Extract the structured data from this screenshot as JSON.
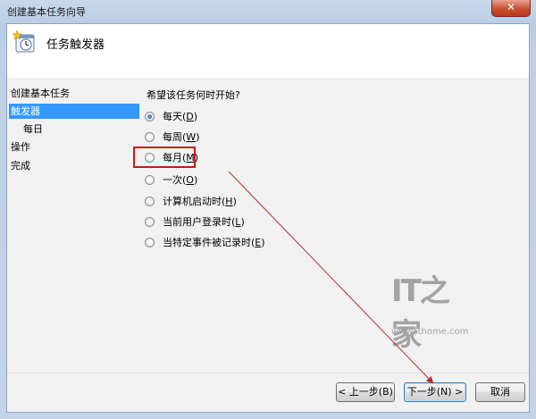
{
  "window": {
    "title": "创建基本任务向导",
    "close_label": "✕"
  },
  "header": {
    "title": "任务触发器",
    "icon": "task-scheduler-clock-icon"
  },
  "nav": {
    "items": [
      {
        "label": "创建基本任务"
      },
      {
        "label": "触发器"
      },
      {
        "label": "每日"
      },
      {
        "label": "操作"
      },
      {
        "label": "完成"
      }
    ]
  },
  "main": {
    "prompt": "希望该任务何时开始?",
    "options": [
      {
        "label": "每天",
        "key": "D",
        "checked": true
      },
      {
        "label": "每周",
        "key": "W",
        "checked": false
      },
      {
        "label": "每月",
        "key": "M",
        "checked": false
      },
      {
        "label": "一次",
        "key": "O",
        "checked": false
      },
      {
        "label": "计算机启动时",
        "key": "H",
        "checked": false
      },
      {
        "label": "当前用户登录时",
        "key": "L",
        "checked": false
      },
      {
        "label": "当特定事件被记录时",
        "key": "E",
        "checked": false
      }
    ]
  },
  "footer": {
    "back_label": "< 上一步(B)",
    "next_label": "下一步(N) >",
    "cancel_label": "取消"
  },
  "watermark": {
    "logo": "IT之家",
    "url": "www.ithome.com"
  },
  "annotation": {
    "box_color": "#d21414",
    "arrow_color": "#b03030"
  }
}
